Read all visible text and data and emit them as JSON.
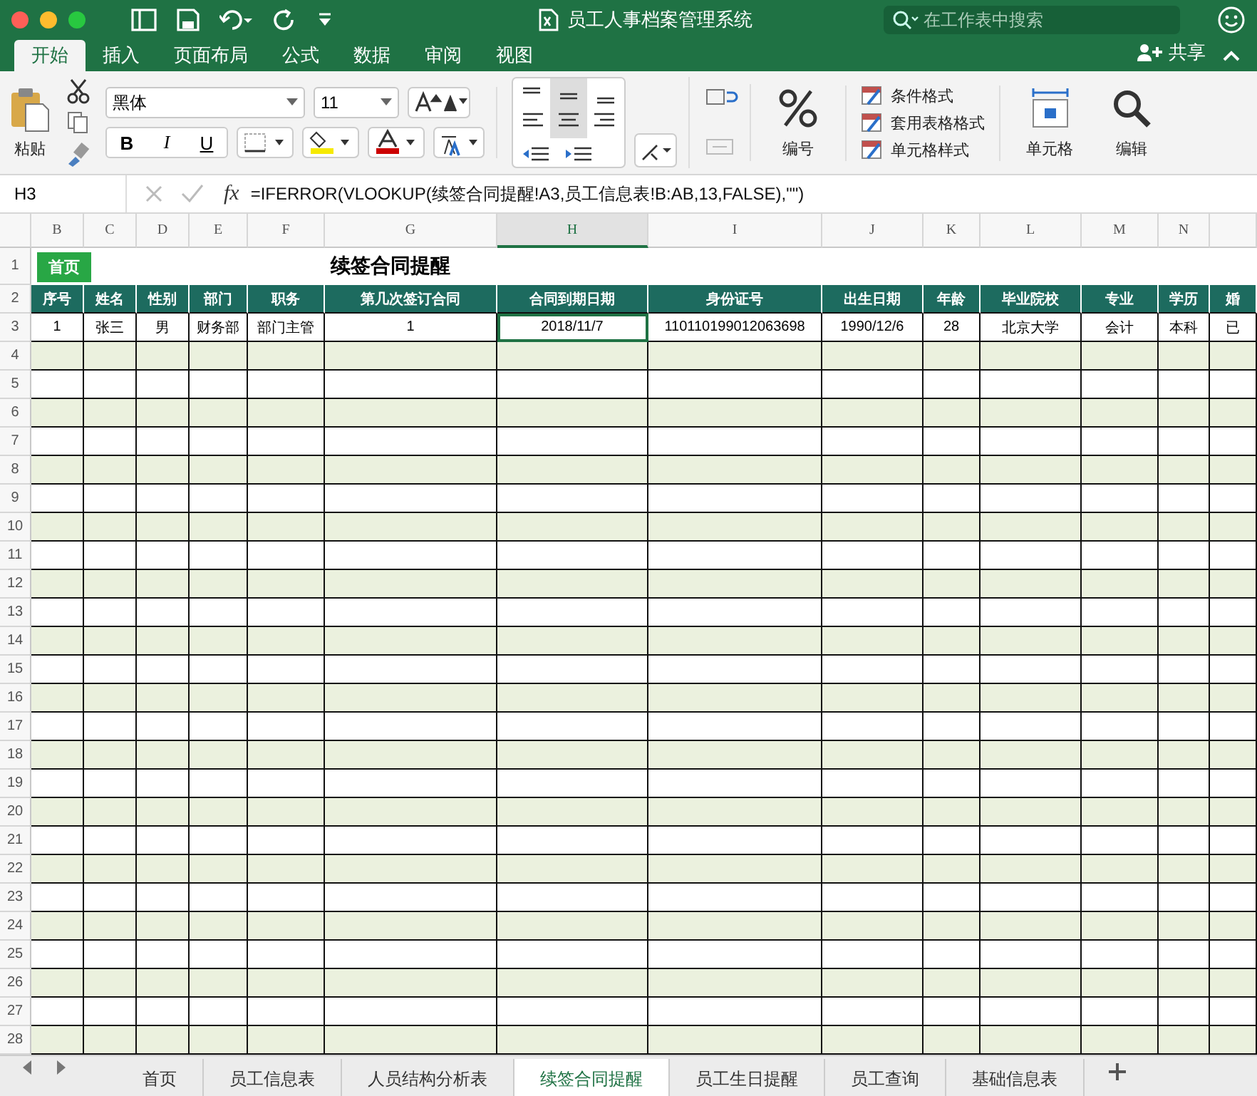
{
  "window": {
    "title": "员工人事档案管理系统",
    "search": {
      "placeholder": "在工作表中搜索"
    }
  },
  "ribbon_tabs": [
    {
      "label": "开始",
      "selected": true
    },
    {
      "label": "插入",
      "selected": false
    },
    {
      "label": "页面布局",
      "selected": false
    },
    {
      "label": "公式",
      "selected": false
    },
    {
      "label": "数据",
      "selected": false
    },
    {
      "label": "审阅",
      "selected": false
    },
    {
      "label": "视图",
      "selected": false
    }
  ],
  "share": "共享",
  "ribbon": {
    "paste": "粘贴",
    "font_name": "黑体",
    "font_size": "11",
    "bold": "B",
    "italic": "I",
    "underline": "U",
    "number": "编号",
    "styles": [
      "条件格式",
      "套用表格格式",
      "单元格样式"
    ],
    "cells": "单元格",
    "editing": "编辑"
  },
  "formula_bar": {
    "cell_ref": "H3",
    "fx": "fx",
    "formula": "=IFERROR(VLOOKUP(续签合同提醒!A3,员工信息表!B:AB,13,FALSE),\"\")"
  },
  "sheet": {
    "columns": [
      {
        "label": "B",
        "selected": false
      },
      {
        "label": "C",
        "selected": false
      },
      {
        "label": "D",
        "selected": false
      },
      {
        "label": "E",
        "selected": false
      },
      {
        "label": "F",
        "selected": false
      },
      {
        "label": "G",
        "selected": false
      },
      {
        "label": "H",
        "selected": true
      },
      {
        "label": "I",
        "selected": false
      },
      {
        "label": "J",
        "selected": false
      },
      {
        "label": "K",
        "selected": false
      },
      {
        "label": "L",
        "selected": false
      },
      {
        "label": "M",
        "selected": false
      },
      {
        "label": "N",
        "selected": false
      }
    ],
    "title_row_number": "1",
    "header_row_number": "2",
    "home_button": "首页",
    "title": "续签合同提醒",
    "header_row": [
      "序号",
      "姓名",
      "性别",
      "部门",
      "职务",
      "第几次签订合同",
      "合同到期日期",
      "身份证号",
      "出生日期",
      "年龄",
      "毕业院校",
      "专业",
      "学历",
      "婚"
    ],
    "data_rows": [
      {
        "number": "3",
        "cells": [
          {
            "text": "1",
            "selected": false
          },
          {
            "text": "张三",
            "selected": false
          },
          {
            "text": "男",
            "selected": false
          },
          {
            "text": "财务部",
            "selected": false
          },
          {
            "text": "部门主管",
            "selected": false
          },
          {
            "text": "1",
            "selected": false
          },
          {
            "text": "2018/11/7",
            "selected": true
          },
          {
            "text": "110110199012063698",
            "selected": false
          },
          {
            "text": "1990/12/6",
            "selected": false
          },
          {
            "text": "28",
            "selected": false
          },
          {
            "text": "北京大学",
            "selected": false
          },
          {
            "text": "会计",
            "selected": false
          },
          {
            "text": "本科",
            "selected": false
          },
          {
            "text": "已",
            "selected": false
          }
        ]
      }
    ],
    "empty_rows": [
      "4",
      "5",
      "6",
      "7",
      "8",
      "9",
      "10",
      "11",
      "12",
      "13",
      "14",
      "15",
      "16",
      "17",
      "18",
      "19",
      "20",
      "21",
      "22",
      "23",
      "24",
      "25",
      "26",
      "27",
      "28"
    ]
  },
  "sheet_tabs": [
    {
      "label": "首页",
      "selected": false
    },
    {
      "label": "员工信息表",
      "selected": false
    },
    {
      "label": "人员结构分析表",
      "selected": false
    },
    {
      "label": "续签合同提醒",
      "selected": true
    },
    {
      "label": "员工生日提醒",
      "selected": false
    },
    {
      "label": "员工查询",
      "selected": false
    },
    {
      "label": "基础信息表",
      "selected": false
    }
  ]
}
